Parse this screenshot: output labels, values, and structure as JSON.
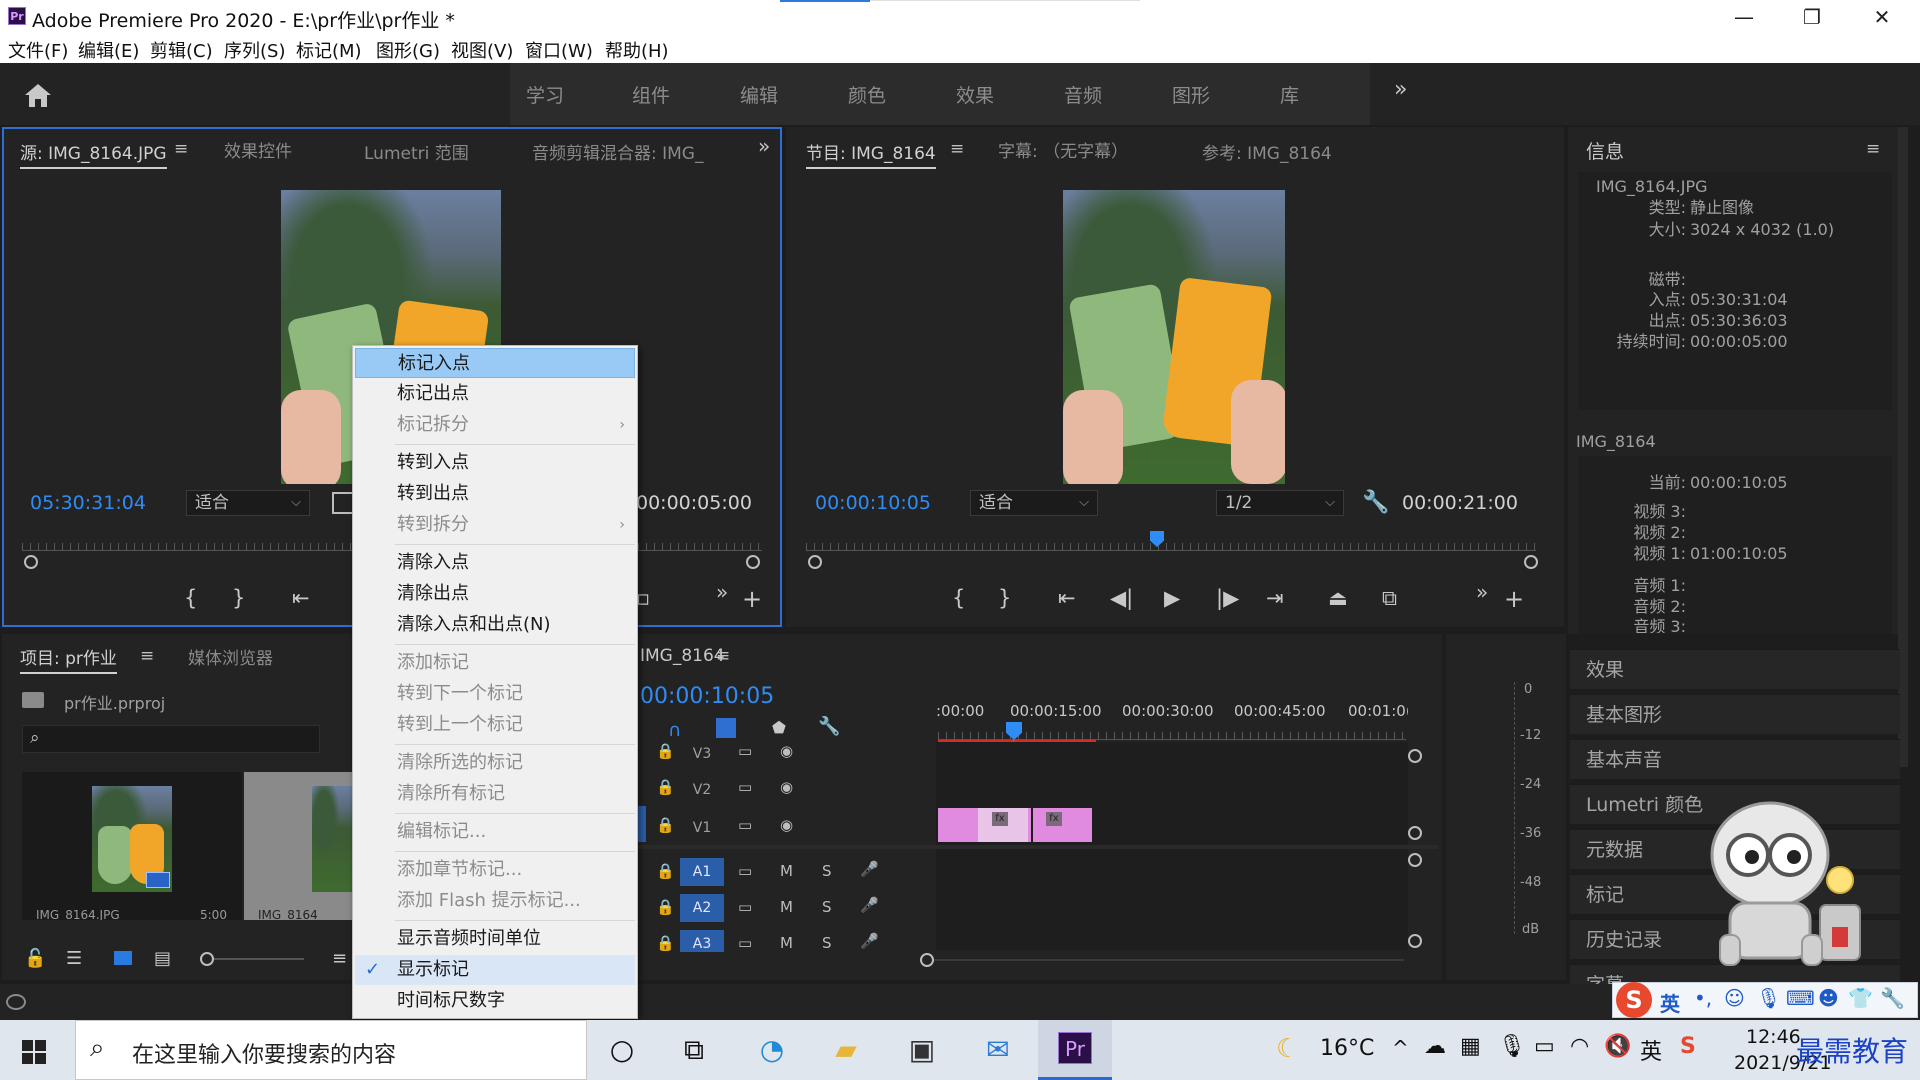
{
  "window": {
    "title": "Adobe Premiere Pro 2020 - E:\\pr作业\\pr作业 *",
    "logo": "Pr",
    "controls": {
      "minimize": "—",
      "maximize": "❐",
      "close": "✕"
    }
  },
  "menubar": [
    "文件(F)",
    "编辑(E)",
    "剪辑(C)",
    "序列(S)",
    "标记(M)",
    "图形(G)",
    "视图(V)",
    "窗口(W)",
    "帮助(H)"
  ],
  "workspaces": [
    "学习",
    "组件",
    "编辑",
    "颜色",
    "效果",
    "音频",
    "图形",
    "库"
  ],
  "workspace_more": "»",
  "source_panel": {
    "tabs": [
      "源: IMG_8164.JPG",
      "效果控件",
      "Lumetri 范围",
      "音频剪辑混合器: IMG_"
    ],
    "active_tab": 0,
    "timecode": "05:30:31:04",
    "fit": "适合",
    "duration": "00:00:05:00"
  },
  "program_panel": {
    "tabs": [
      "节目: IMG_8164",
      "字幕: （无字幕）",
      "参考: IMG_8164"
    ],
    "timecode": "00:00:10:05",
    "fit": "适合",
    "resolution": "1/2",
    "duration": "00:00:21:00"
  },
  "info_panel": {
    "title": "信息",
    "clip_name": "IMG_8164.JPG",
    "type_label": "类型:",
    "type_value": "静止图像",
    "size_label": "大小:",
    "size_value": "3024 x 4032 (1.0)",
    "tape_label": "磁带:",
    "in_label": "入点:",
    "in_value": "05:30:31:04",
    "out_label": "出点:",
    "out_value": "05:30:36:03",
    "dur_label": "持续时间:",
    "dur_value": "00:00:05:00",
    "seq_name": "IMG_8164",
    "current_label": "当前:",
    "current_value": "00:00:10:05",
    "v3": "视频 3:",
    "v2": "视频 2:",
    "v1": "视频 1:",
    "v1_value": "01:00:10:05",
    "a1": "音频 1:",
    "a2": "音频 2:",
    "a3": "音频 3:"
  },
  "side_panels": [
    "效果",
    "基本图形",
    "基本声音",
    "Lumetri 颜色",
    "元数据",
    "标记",
    "历史记录",
    "字幕"
  ],
  "project_panel": {
    "tabs": [
      "项目: pr作业",
      "媒体浏览器"
    ],
    "file": "pr作业.prproj",
    "items": [
      {
        "name": "IMG_8164.JPG",
        "duration": "5:00"
      },
      {
        "name": "IMG_8164"
      }
    ]
  },
  "timeline": {
    "tab": "IMG_8164",
    "timecode": "00:00:10:05",
    "ruler": [
      ":00:00",
      "00:00:15:00",
      "00:00:30:00",
      "00:00:45:00",
      "00:01:0("
    ],
    "video_tracks": [
      "V3",
      "V2",
      "V1"
    ],
    "audio_tracks": [
      "A1",
      "A2",
      "A3"
    ],
    "m": "M",
    "s": "S",
    "fx": "fx"
  },
  "meter": {
    "labels": [
      "0",
      "-12",
      "-24",
      "-36",
      "-48",
      "dB"
    ]
  },
  "context_menu": {
    "items": [
      {
        "label": "标记入点",
        "enabled": true,
        "highlighted": true
      },
      {
        "label": "标记出点",
        "enabled": true
      },
      {
        "label": "标记拆分",
        "enabled": false,
        "submenu": true
      },
      {
        "label": "转到入点",
        "enabled": true
      },
      {
        "label": "转到出点",
        "enabled": true
      },
      {
        "label": "转到拆分",
        "enabled": false,
        "submenu": true
      },
      {
        "label": "清除入点",
        "enabled": true
      },
      {
        "label": "清除出点",
        "enabled": true
      },
      {
        "label": "清除入点和出点(N)",
        "enabled": true
      },
      {
        "label": "添加标记",
        "enabled": false
      },
      {
        "label": "转到下一个标记",
        "enabled": false
      },
      {
        "label": "转到上一个标记",
        "enabled": false
      },
      {
        "label": "清除所选的标记",
        "enabled": false
      },
      {
        "label": "清除所有标记",
        "enabled": false
      },
      {
        "label": "编辑标记...",
        "enabled": false
      },
      {
        "label": "添加章节标记...",
        "enabled": false
      },
      {
        "label": "添加 Flash 提示标记...",
        "enabled": false
      },
      {
        "label": "显示音频时间单位",
        "enabled": true
      },
      {
        "label": "显示标记",
        "enabled": true,
        "checked": true
      },
      {
        "label": "时间标尺数字",
        "enabled": true
      }
    ],
    "submenu_arrow": "›",
    "check": "✓"
  },
  "taskbar": {
    "search_placeholder": "在这里输入你要搜索的内容",
    "weather": "16°C",
    "time": "12:46",
    "date": "2021/9/21",
    "ime_lang": "英",
    "ime_punct": "•,",
    "watermark": "最需教育"
  }
}
